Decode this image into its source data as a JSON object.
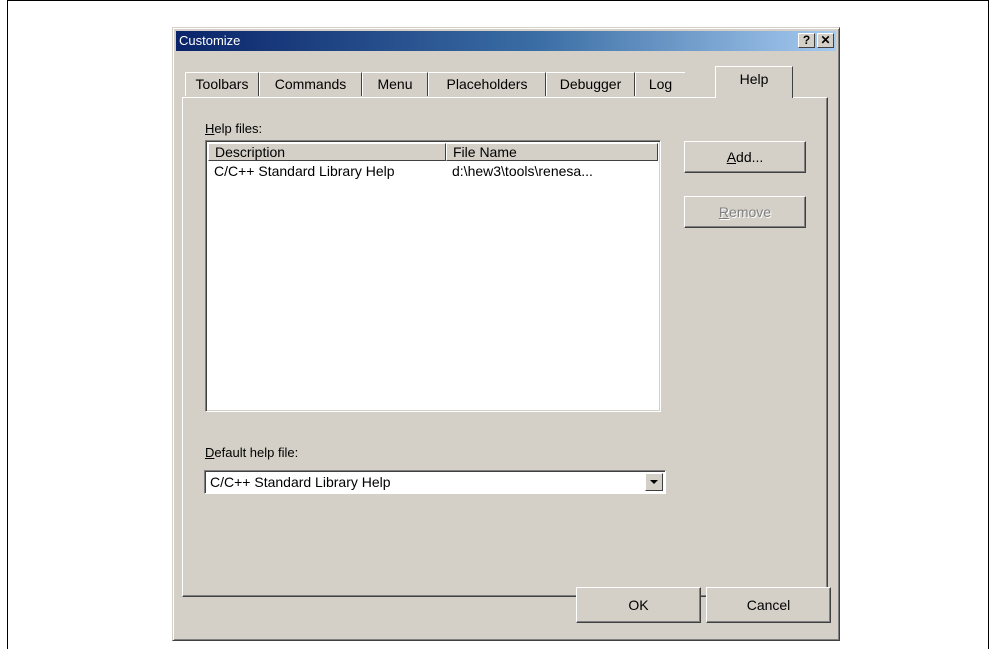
{
  "window": {
    "title": "Customize",
    "help_btn": "?",
    "close_btn": "✕"
  },
  "tabs": [
    {
      "label": "Toolbars"
    },
    {
      "label": "Commands"
    },
    {
      "label": "Menu"
    },
    {
      "label": "Placeholders"
    },
    {
      "label": "Debugger"
    },
    {
      "label": "Log"
    },
    {
      "label": "Help",
      "active": true
    }
  ],
  "help_files": {
    "label_prefix": "H",
    "label_rest": "elp files:",
    "columns": [
      "Description",
      "File Name"
    ],
    "rows": [
      {
        "description": "C/C++ Standard Library Help",
        "file_name": "d:\\hew3\\tools\\renesa..."
      }
    ]
  },
  "buttons": {
    "add_prefix": "A",
    "add_rest": "dd...",
    "remove_prefix": "R",
    "remove_rest": "emove",
    "ok": "OK",
    "cancel": "Cancel"
  },
  "default_help": {
    "label_prefix": "D",
    "label_rest": "efault help file:",
    "selected": "C/C++ Standard Library Help"
  }
}
